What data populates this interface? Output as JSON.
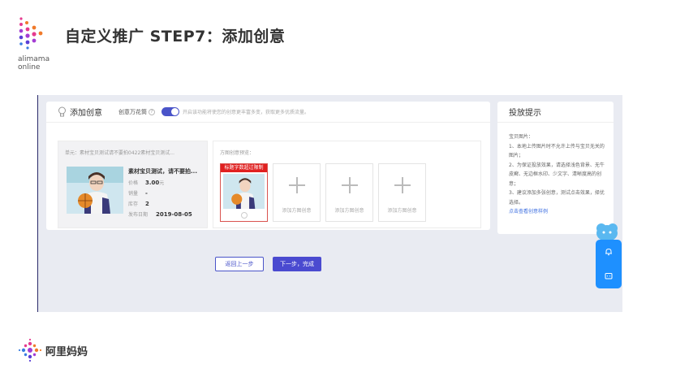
{
  "slide": {
    "title": "自定义推广 STEP7：添加创意",
    "logo_text_line1": "alimama",
    "logo_text_line2": "online",
    "bottom_logo_text": "阿里妈妈"
  },
  "panel": {
    "title": "添加创意",
    "feature_label": "创意万花筒",
    "toggle_on": true,
    "feature_hint": "开启该功能将使您的创意更丰富多变，获取更多优质流量。"
  },
  "product": {
    "unit_line": "单元：素材宝贝测试请不要拍0422素材宝贝测试...",
    "name": "素材宝贝测试，请不要拍...",
    "rows": [
      {
        "label": "价格",
        "value": "3.00",
        "unit": "元"
      },
      {
        "label": "销量",
        "value": "-",
        "unit": ""
      },
      {
        "label": "库存",
        "value": "2",
        "unit": ""
      },
      {
        "label": "发布日期",
        "value": "2019-08-05",
        "unit": ""
      }
    ]
  },
  "preview": {
    "label": "方图创意预览：",
    "warning": "标题字数超过限制",
    "add_label": "添加方图创意"
  },
  "tips": {
    "title": "投放提示",
    "lines": [
      "宝贝图片：",
      "1、本地上传图片时不允许上传与宝贝无关的图片；",
      "2、为保证投放效果，请选择浅色背景、无牛皮癣、无边框水印、少文字、清晰度高的创意；",
      "3、建议添加多张创意，测试点击效果，择优选择。"
    ],
    "link": "点击查看创意样例"
  },
  "buttons": {
    "back": "返回上一步",
    "next": "下一步，完成"
  },
  "colors": {
    "accent": "#4a4ad0",
    "warning": "#e02020",
    "float": "#1e90ff",
    "link": "#3c6ee0"
  },
  "icons": {
    "bulb": "lightbulb-icon",
    "help": "question-icon",
    "bell": "bell-icon",
    "chat": "chat-icon"
  }
}
